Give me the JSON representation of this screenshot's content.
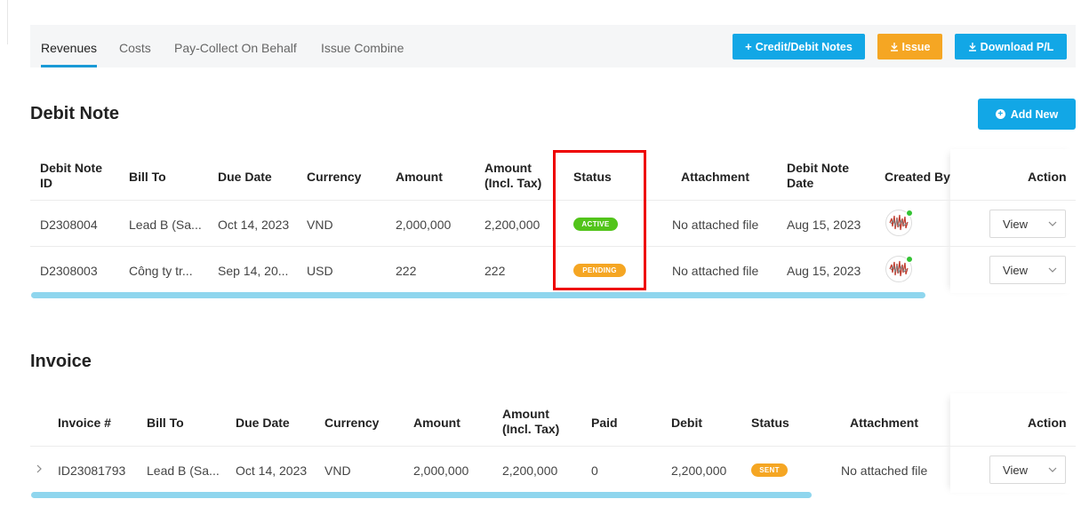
{
  "tabs": [
    {
      "label": "Revenues",
      "active": true
    },
    {
      "label": "Costs",
      "active": false
    },
    {
      "label": "Pay-Collect On Behalf",
      "active": false
    },
    {
      "label": "Issue Combine",
      "active": false
    }
  ],
  "toolbar": {
    "credit_debit_label": "Credit/Debit Notes",
    "issue_label": "Issue",
    "download_label": "Download P/L"
  },
  "debit_note": {
    "title": "Debit Note",
    "add_new_label": "Add New",
    "headers": {
      "id_1": "Debit Note",
      "id_2": "ID",
      "bill_to": "Bill To",
      "due_date": "Due Date",
      "currency": "Currency",
      "amount": "Amount",
      "amount_tax_1": "Amount",
      "amount_tax_2": "(Incl. Tax)",
      "status": "Status",
      "attachment": "Attachment",
      "dn_date_1": "Debit Note",
      "dn_date_2": "Date",
      "created_by": "Created By",
      "action": "Action"
    },
    "rows": [
      {
        "id": "D2308004",
        "bill_to": "Lead B (Sa...",
        "due_date": "Oct 14, 2023",
        "currency": "VND",
        "amount": "2,000,000",
        "amount_tax": "2,200,000",
        "status": "ACTIVE",
        "attachment": "No attached file",
        "date": "Aug 15, 2023",
        "view": "View"
      },
      {
        "id": "D2308003",
        "bill_to": "Công ty tr...",
        "due_date": "Sep 14, 20...",
        "currency": "USD",
        "amount": "222",
        "amount_tax": "222",
        "status": "PENDING",
        "attachment": "No attached file",
        "date": "Aug 15, 2023",
        "view": "View"
      }
    ]
  },
  "invoice": {
    "title": "Invoice",
    "headers": {
      "invoice_no": "Invoice #",
      "bill_to": "Bill To",
      "due_date": "Due Date",
      "currency": "Currency",
      "amount": "Amount",
      "amount_tax_1": "Amount",
      "amount_tax_2": "(Incl. Tax)",
      "paid": "Paid",
      "debit": "Debit",
      "status": "Status",
      "attachment": "Attachment",
      "action": "Action"
    },
    "rows": [
      {
        "invoice_no": "ID23081793",
        "bill_to": "Lead B (Sa...",
        "due_date": "Oct 14, 2023",
        "currency": "VND",
        "amount": "2,000,000",
        "amount_tax": "2,200,000",
        "paid": "0",
        "debit": "2,200,000",
        "status": "SENT",
        "attachment": "No attached file",
        "view": "View"
      }
    ]
  },
  "colors": {
    "primary": "#12a7e6",
    "accent_orange": "#f5a623",
    "status_active": "#52c41a",
    "status_pending": "#f5a623",
    "highlight": "#ee0000"
  }
}
